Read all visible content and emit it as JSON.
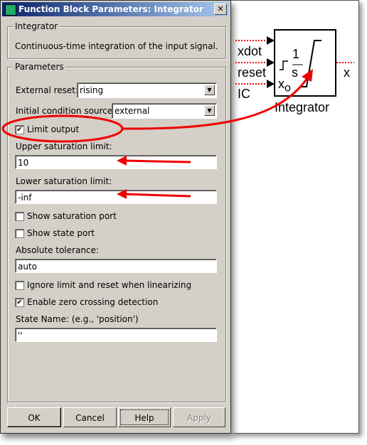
{
  "window": {
    "title": "Function Block Parameters: Integrator",
    "close": "✕"
  },
  "description": {
    "group": "Integrator",
    "text": "Continuous-time integration of the input signal."
  },
  "params": {
    "group": "Parameters",
    "external_reset": {
      "label": "External reset:",
      "value": "rising"
    },
    "ic_source": {
      "label": "Initial condition source:",
      "value": "external"
    },
    "limit_output": {
      "label": "Limit output",
      "checked": true
    },
    "upper": {
      "label": "Upper saturation limit:",
      "value": "10"
    },
    "lower": {
      "label": "Lower saturation limit:",
      "value": "-inf"
    },
    "show_sat": {
      "label": "Show saturation port",
      "checked": false
    },
    "show_state": {
      "label": "Show state port",
      "checked": false
    },
    "abstol": {
      "label": "Absolute tolerance:",
      "value": "auto"
    },
    "ignore_limit": {
      "label": "Ignore limit and reset when linearizing",
      "checked": false
    },
    "zero_cross": {
      "label": "Enable zero crossing detection",
      "checked": true
    },
    "state_name": {
      "label": "State Name: (e.g., 'position')",
      "value": "''"
    }
  },
  "buttons": {
    "ok": "OK",
    "cancel": "Cancel",
    "help": "Help",
    "apply": "Apply"
  },
  "block": {
    "name": "Integrator",
    "inputs": [
      "xdot",
      "reset",
      "IC"
    ],
    "output": "x",
    "tf_num": "1",
    "tf_den": "s",
    "x0": "x",
    "x0_sub": "o"
  },
  "colors": {
    "annotation": "#e00000",
    "title_start": "#0a246a",
    "title_end": "#a6caf0"
  }
}
